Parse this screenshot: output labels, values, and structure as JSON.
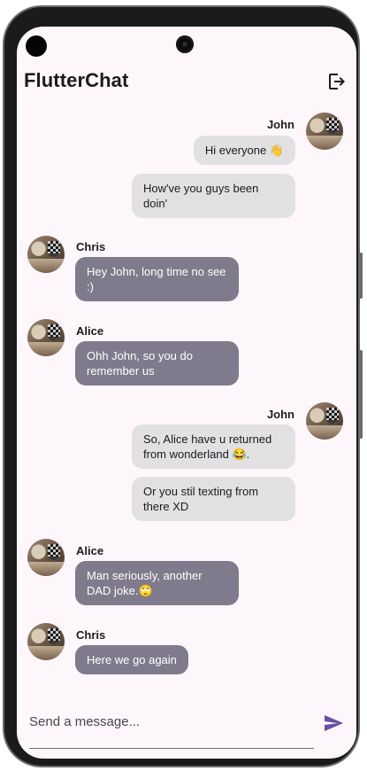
{
  "app": {
    "title": "FlutterChat"
  },
  "header": {
    "logout_icon": "logout-icon"
  },
  "messages": [
    {
      "sender": "John",
      "side": "right",
      "texts": [
        "Hi everyone 👋",
        "How've you guys been doin'"
      ]
    },
    {
      "sender": "Chris",
      "side": "left",
      "texts": [
        "Hey John, long time no see :)"
      ]
    },
    {
      "sender": "Alice",
      "side": "left",
      "texts": [
        "Ohh John, so you do remember us"
      ]
    },
    {
      "sender": "John",
      "side": "right",
      "texts": [
        "So, Alice have u returned from wonderland 😂.",
        "Or you stil texting from there XD"
      ]
    },
    {
      "sender": "Alice",
      "side": "left",
      "texts": [
        "Man seriously, another DAD joke.🙄"
      ]
    },
    {
      "sender": "Chris",
      "side": "left",
      "texts": [
        "Here we go again"
      ]
    }
  ],
  "composer": {
    "placeholder": "Send a message...",
    "send_icon": "send-icon"
  },
  "colors": {
    "background": "#fdf7fc",
    "outgoing_bubble": "#e1e0e2",
    "incoming_bubble": "#7f7b8c",
    "accent": "#6750a4"
  }
}
